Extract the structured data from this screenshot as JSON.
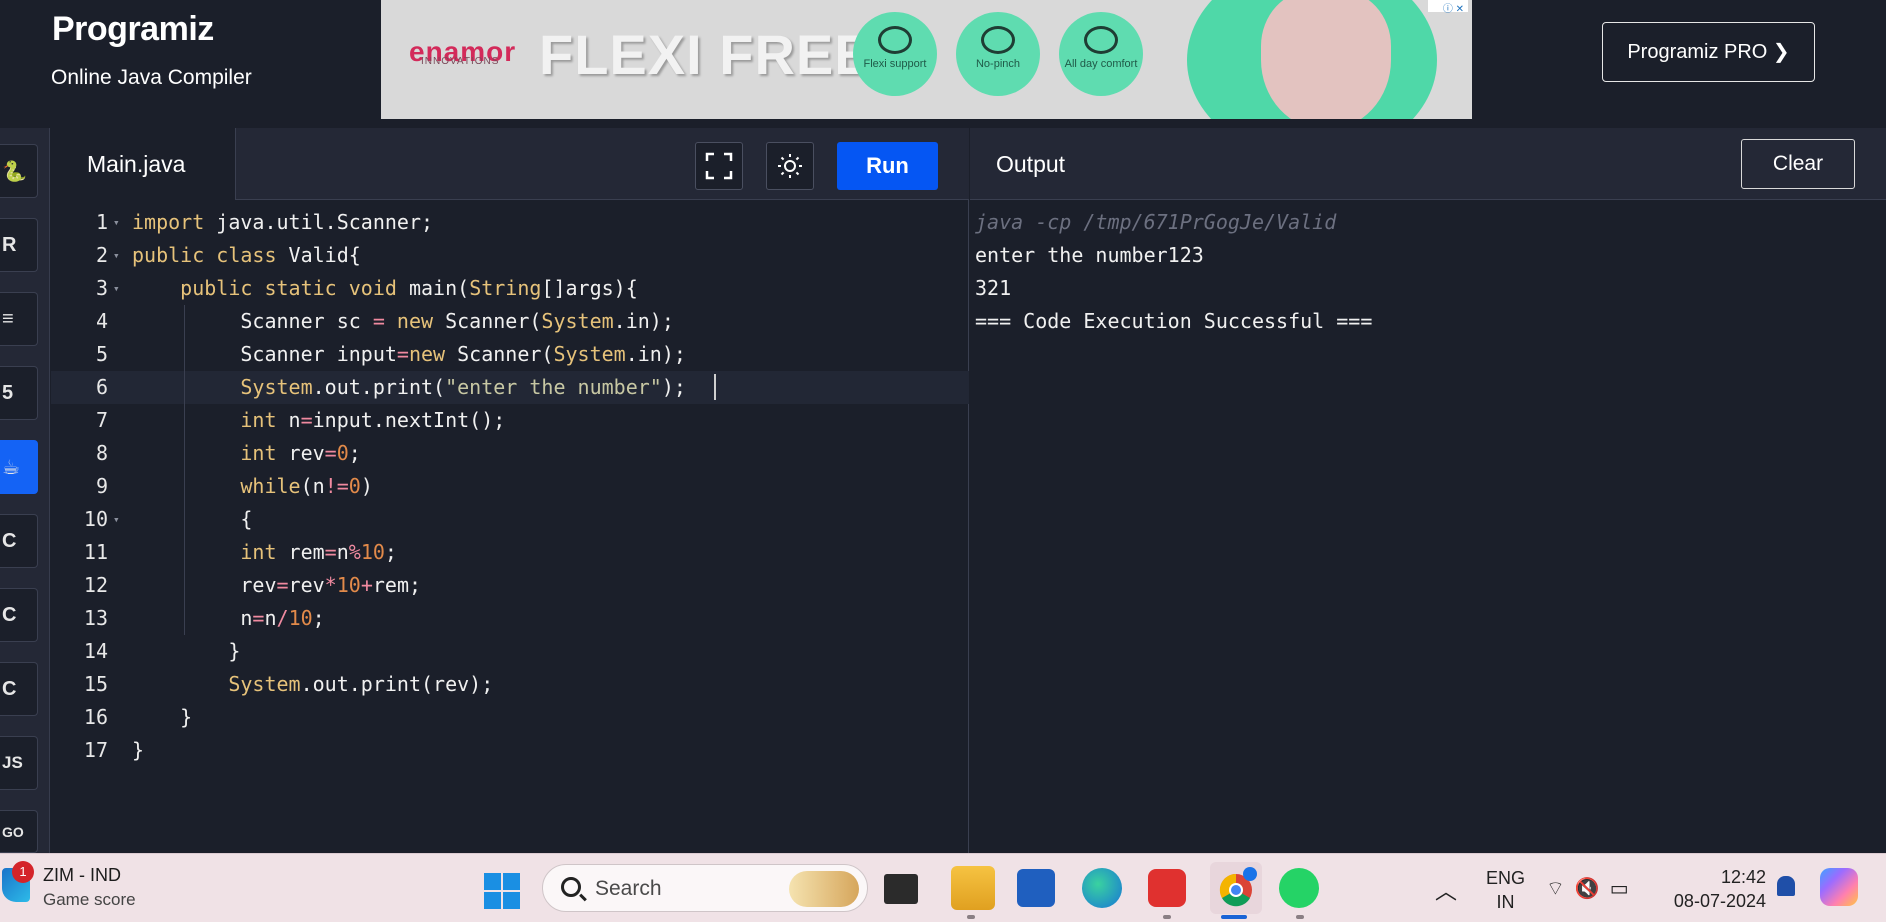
{
  "header": {
    "logo": "Programiz",
    "subtitle": "Online Java Compiler",
    "pro_button": "Programiz PRO ❯"
  },
  "ad": {
    "brand": "enamor",
    "brand_sub": "INNOVATIONS",
    "headline": "FLEXI FREE",
    "badges": [
      {
        "label": "Flexi support"
      },
      {
        "label": "No-pinch"
      },
      {
        "label": "All day comfort"
      }
    ]
  },
  "rail": {
    "items": [
      {
        "name": "python"
      },
      {
        "name": "r"
      },
      {
        "name": "sql"
      },
      {
        "name": "html"
      },
      {
        "name": "java",
        "active": true
      },
      {
        "name": "c"
      },
      {
        "name": "cpp"
      },
      {
        "name": "csharp"
      },
      {
        "name": "javascript",
        "label": "JS"
      },
      {
        "name": "go",
        "label": "GO"
      }
    ]
  },
  "editor": {
    "tab": "Main.java",
    "run_label": "Run",
    "line_numbers": [
      "1",
      "2",
      "3",
      "4",
      "5",
      "6",
      "7",
      "8",
      "9",
      "10",
      "11",
      "12",
      "13",
      "14",
      "15",
      "16",
      "17"
    ],
    "lines": [
      "import java.util.Scanner;",
      "public class Valid{",
      "    public static void main(String[]args){",
      "         Scanner sc = new Scanner(System.in);",
      "         Scanner input=new Scanner(System.in);",
      "         System.out.print(\"enter the number\");",
      "         int n=input.nextInt();",
      "         int rev=0;",
      "         while(n!=0)",
      "         {",
      "         int rem=n%10;",
      "         rev=rev*10+rem;",
      "         n=n/10;",
      "        }",
      "        System.out.print(rev);",
      "    }",
      "}"
    ]
  },
  "output": {
    "title": "Output",
    "clear_label": "Clear",
    "lines": [
      "java -cp /tmp/671PrGogJe/Valid",
      "enter the number123",
      "321",
      "=== Code Execution Successful ==="
    ]
  },
  "taskbar": {
    "weather_title": "ZIM - IND",
    "weather_sub": "Game score",
    "weather_badge": "1",
    "search_placeholder": "Search",
    "lang_line1": "ENG",
    "lang_line2": "IN",
    "time": "12:42",
    "date": "08-07-2024"
  }
}
